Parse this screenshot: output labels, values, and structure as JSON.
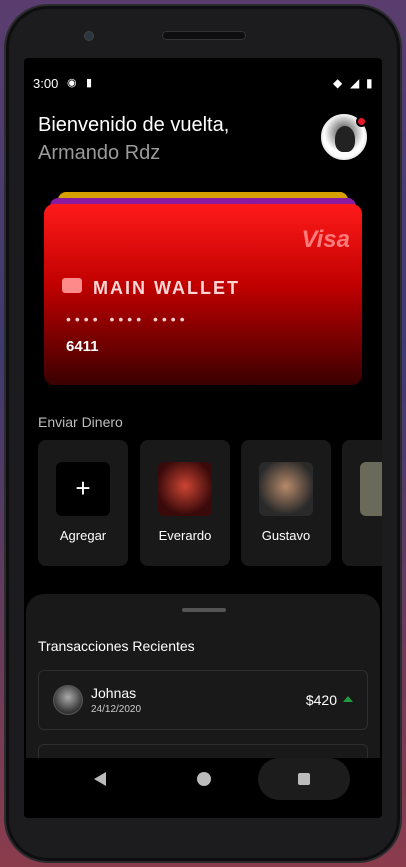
{
  "status": {
    "time": "3:00"
  },
  "header": {
    "greeting": "Bienvenido de vuelta,",
    "user_name": "Armando Rdz"
  },
  "card": {
    "brand": "Visa",
    "wallet_label": "MAIN WALLET",
    "masked": "•••• •••• ••••",
    "last4": "6411"
  },
  "send": {
    "title": "Enviar Dinero",
    "tiles": [
      {
        "label": "Agregar",
        "icon": "plus-icon"
      },
      {
        "label": "Everardo"
      },
      {
        "label": "Gustavo"
      }
    ]
  },
  "transactions": {
    "title": "Transacciones Recientes",
    "items": [
      {
        "name": "Johnas",
        "date": "24/12/2020",
        "amount": "$420",
        "direction": "up",
        "color": "#1f9d3a"
      }
    ]
  },
  "colors": {
    "card_top": "#ff1a1a",
    "card_bottom": "#3a0000",
    "accent": "#e8192c"
  }
}
